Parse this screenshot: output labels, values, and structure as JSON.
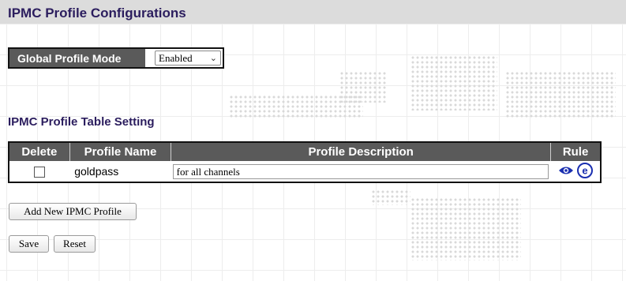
{
  "page": {
    "title": "IPMC Profile Configurations"
  },
  "global_profile_mode": {
    "label": "Global Profile Mode",
    "value": "Enabled",
    "options": [
      "Enabled"
    ]
  },
  "profile_table": {
    "title": "IPMC Profile Table Setting",
    "headers": {
      "delete": "Delete",
      "name": "Profile Name",
      "description": "Profile Description",
      "rule": "Rule"
    },
    "rows": [
      {
        "delete_checked": false,
        "name": "goldpass",
        "description": "for all channels",
        "rule_icons": [
          "view-eye-icon",
          "edit-e-icon"
        ]
      }
    ]
  },
  "buttons": {
    "add_profile": "Add New IPMC Profile",
    "save": "Save",
    "reset": "Reset"
  },
  "colors": {
    "header_bg": "#5a5a5a",
    "title_bar_bg": "#dcdcdc",
    "title_text": "#2b1d5e",
    "icon_blue": "#1a2fb0"
  }
}
